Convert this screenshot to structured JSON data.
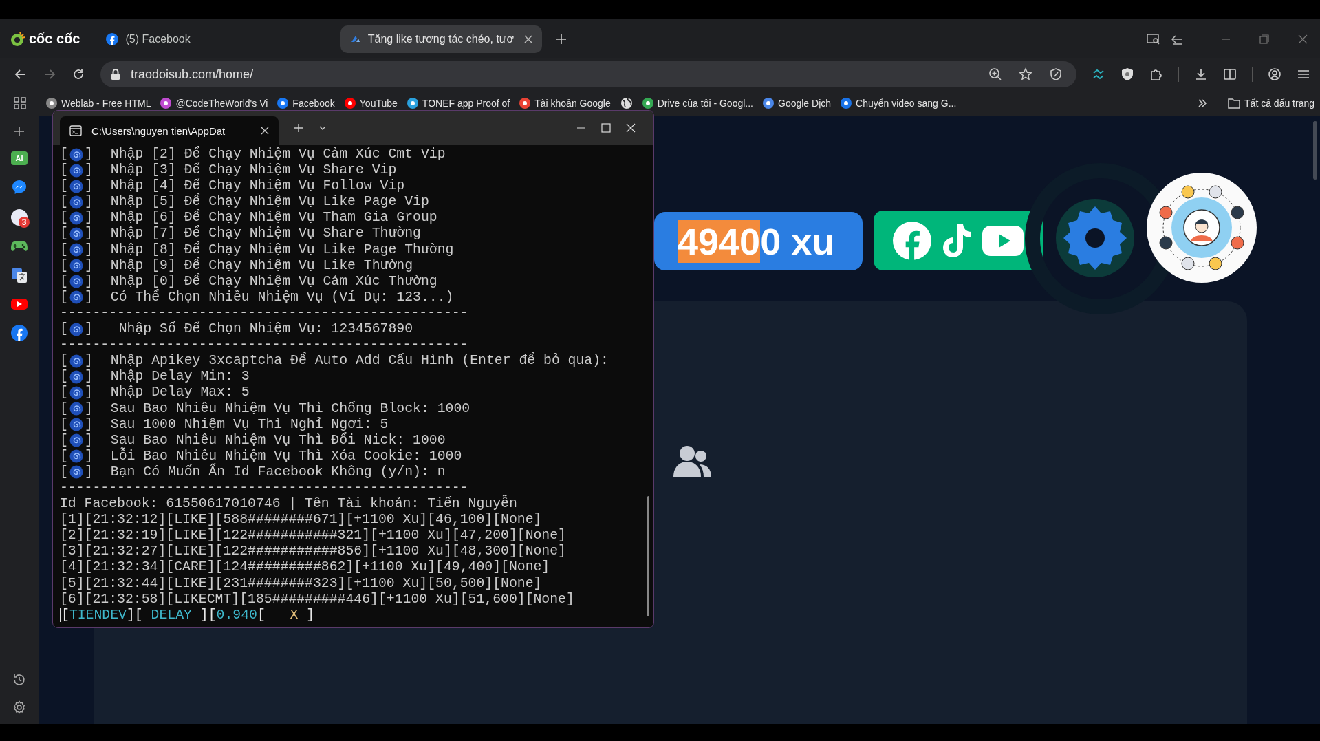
{
  "browser": {
    "brand": "cốc cốc",
    "tabs": [
      {
        "title": "(5) Facebook",
        "selected": false
      },
      {
        "title": "Tăng like tương tác chéo, tươ",
        "selected": true
      }
    ],
    "url": "traodoisub.com/home/",
    "bookmarks": [
      {
        "kind": "link",
        "label": "Weblab - Free HTML"
      },
      {
        "kind": "link",
        "label": "@CodeTheWorld's Vi"
      },
      {
        "kind": "link",
        "label": "Facebook"
      },
      {
        "kind": "link",
        "label": "YouTube"
      },
      {
        "kind": "link",
        "label": "TONEF app Proof of"
      },
      {
        "kind": "link",
        "label": "Tài khoản Google"
      },
      {
        "kind": "icon"
      },
      {
        "kind": "link",
        "label": "Drive của tôi - Googl..."
      },
      {
        "kind": "link",
        "label": "Google Dịch"
      },
      {
        "kind": "link",
        "label": "Chuyển video sang G..."
      }
    ],
    "all_bookmarks": "Tất cả dấu trang"
  },
  "sidebar": [
    {
      "kind": "add"
    },
    {
      "kind": "ai",
      "label": "AI"
    },
    {
      "kind": "messenger"
    },
    {
      "kind": "chat",
      "badge": "3"
    },
    {
      "kind": "game"
    },
    {
      "kind": "translate"
    },
    {
      "kind": "youtube"
    },
    {
      "kind": "facebook"
    }
  ],
  "page": {
    "balance": {
      "selected": "4940",
      "rest": "0 xu"
    }
  },
  "terminal": {
    "tab_title": "C:\\Users\\nguyen tien\\AppDat",
    "lines": [
      {
        "kind": "bullet",
        "pre": "[",
        "post": "]",
        "text": "Nhập [2] Để Chạy Nhiệm Vụ Cảm Xúc Cmt Vip"
      },
      {
        "kind": "bullet",
        "pre": "[",
        "post": "]",
        "text": "Nhập [3] Để Chạy Nhiệm Vụ Share Vip"
      },
      {
        "kind": "bullet",
        "pre": "[",
        "post": "]",
        "text": "Nhập [4] Để Chạy Nhiệm Vụ Follow Vip"
      },
      {
        "kind": "bullet",
        "pre": "[",
        "post": "]",
        "text": "Nhập [5] Để Chạy Nhiệm Vụ Like Page Vip"
      },
      {
        "kind": "bullet",
        "pre": "[",
        "post": "]",
        "text": "Nhập [6] Để Chạy Nhiệm Vụ Tham Gia Group"
      },
      {
        "kind": "bullet",
        "pre": "[",
        "post": "]",
        "text": "Nhập [7] Để Chạy Nhiệm Vụ Share Thường"
      },
      {
        "kind": "bullet",
        "pre": "[",
        "post": "]",
        "text": "Nhập [8] Để Chạy Nhiệm Vụ Like Page Thường"
      },
      {
        "kind": "bullet",
        "pre": "[",
        "post": "]",
        "text": "Nhập [9] Để Chạy Nhiệm Vụ Like Thường"
      },
      {
        "kind": "bullet",
        "pre": "[",
        "post": "]",
        "text": "Nhập [0] Để Chạy Nhiệm Vụ Cảm Xúc Thường"
      },
      {
        "kind": "bullet",
        "pre": "[",
        "post": "]",
        "text": "Có Thể Chọn Nhiều Nhiệm Vụ (Ví Dụ: 123...)"
      },
      {
        "kind": "rule",
        "text": "--------------------------------------------------"
      },
      {
        "kind": "bullet",
        "pre": "[",
        "post": "]",
        "text": "Nhập Số Để Chọn Nhiệm Vụ: 1234567890",
        "indent": true
      },
      {
        "kind": "rule",
        "text": "--------------------------------------------------"
      },
      {
        "kind": "bullet",
        "pre": "[",
        "post": "]",
        "text": "Nhập Apikey 3xcaptcha Để Auto Add Cấu Hình (Enter để bỏ qua):"
      },
      {
        "kind": "bullet",
        "pre": "[",
        "post": "]",
        "text": "Nhập Delay Min: 3"
      },
      {
        "kind": "bullet",
        "pre": "[",
        "post": "]",
        "text": "Nhập Delay Max: 5"
      },
      {
        "kind": "bullet",
        "pre": "[",
        "post": "]",
        "text": "Sau Bao Nhiêu Nhiệm Vụ Thì Chống Block: 1000"
      },
      {
        "kind": "bullet",
        "pre": "[",
        "post": "]",
        "text": "Sau 1000 Nhiệm Vụ Thì Nghỉ Ngơi: 5"
      },
      {
        "kind": "bullet",
        "pre": "[",
        "post": "]",
        "text": "Sau Bao Nhiêu Nhiệm Vụ Thì Đổi Nick: 1000"
      },
      {
        "kind": "bullet",
        "pre": "[",
        "post": "]",
        "text": "Lỗi Bao Nhiêu Nhiệm Vụ Thì Xóa Cookie: 1000"
      },
      {
        "kind": "bullet",
        "pre": "[",
        "post": "]",
        "text": "Bạn Có Muốn Ẩn Id Facebook Không (y/n): n"
      },
      {
        "kind": "rule",
        "text": "--------------------------------------------------"
      },
      {
        "kind": "plain",
        "text": "Id Facebook: 61550617010746 | Tên Tài khoản: Tiến Nguyễn"
      },
      {
        "kind": "plain",
        "text": "[1][21:32:12][LIKE][588########671][+1100 Xu][46,100][None]"
      },
      {
        "kind": "plain",
        "text": "[2][21:32:19][LIKE][122###########321][+1100 Xu][47,200][None]"
      },
      {
        "kind": "plain",
        "text": "[3][21:32:27][LIKE][122###########856][+1100 Xu][48,300][None]"
      },
      {
        "kind": "plain",
        "text": "[4][21:32:34][CARE][124#########862][+1100 Xu][49,400][None]"
      },
      {
        "kind": "plain",
        "text": "[5][21:32:44][LIKE][231########323][+1100 Xu][50,500][None]"
      },
      {
        "kind": "plain",
        "text": "[6][21:32:58][LIKECMT][185#########446][+1100 Xu][51,600][None]"
      }
    ],
    "status": [
      {
        "text": "[",
        "color": "#e6e6e6"
      },
      {
        "text": "TIENDEV",
        "color": "#3fb8cc"
      },
      {
        "text": "][ ",
        "color": "#e6e6e6"
      },
      {
        "text": "DELAY",
        "color": "#3fb8cc"
      },
      {
        "text": " ][",
        "color": "#e6e6e6"
      },
      {
        "text": "0.940",
        "color": "#3fb8cc"
      },
      {
        "text": "[   ",
        "color": "#e6e6e6"
      },
      {
        "text": "X",
        "color": "#e5c07b"
      },
      {
        "text": " ]",
        "color": "#e6e6e6"
      }
    ]
  }
}
